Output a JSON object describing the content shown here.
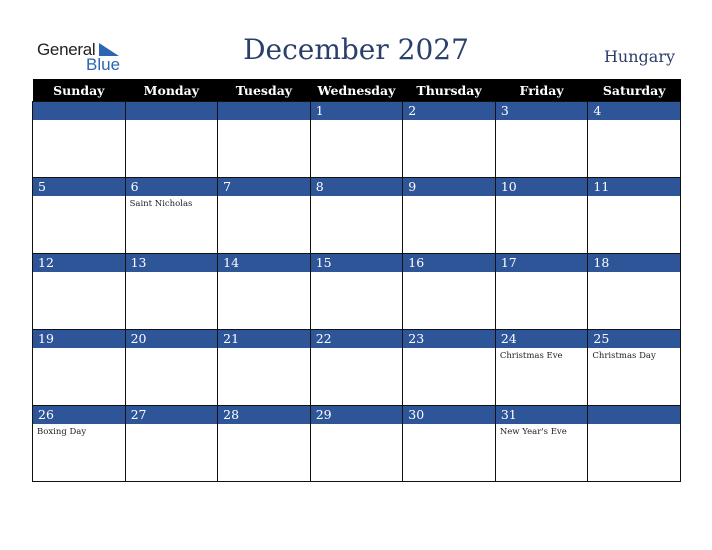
{
  "logo": {
    "word1": "General",
    "word2": "Blue"
  },
  "title": "December 2027",
  "country": "Hungary",
  "colors": {
    "band": "#2e5597",
    "header": "#000000",
    "title": "#2b3f6b"
  },
  "weekdays": [
    "Sunday",
    "Monday",
    "Tuesday",
    "Wednesday",
    "Thursday",
    "Friday",
    "Saturday"
  ],
  "weeks": [
    [
      {
        "day": "",
        "holiday": ""
      },
      {
        "day": "",
        "holiday": ""
      },
      {
        "day": "",
        "holiday": ""
      },
      {
        "day": "1",
        "holiday": ""
      },
      {
        "day": "2",
        "holiday": ""
      },
      {
        "day": "3",
        "holiday": ""
      },
      {
        "day": "4",
        "holiday": ""
      }
    ],
    [
      {
        "day": "5",
        "holiday": ""
      },
      {
        "day": "6",
        "holiday": "Saint Nicholas"
      },
      {
        "day": "7",
        "holiday": ""
      },
      {
        "day": "8",
        "holiday": ""
      },
      {
        "day": "9",
        "holiday": ""
      },
      {
        "day": "10",
        "holiday": ""
      },
      {
        "day": "11",
        "holiday": ""
      }
    ],
    [
      {
        "day": "12",
        "holiday": ""
      },
      {
        "day": "13",
        "holiday": ""
      },
      {
        "day": "14",
        "holiday": ""
      },
      {
        "day": "15",
        "holiday": ""
      },
      {
        "day": "16",
        "holiday": ""
      },
      {
        "day": "17",
        "holiday": ""
      },
      {
        "day": "18",
        "holiday": ""
      }
    ],
    [
      {
        "day": "19",
        "holiday": ""
      },
      {
        "day": "20",
        "holiday": ""
      },
      {
        "day": "21",
        "holiday": ""
      },
      {
        "day": "22",
        "holiday": ""
      },
      {
        "day": "23",
        "holiday": ""
      },
      {
        "day": "24",
        "holiday": "Christmas Eve"
      },
      {
        "day": "25",
        "holiday": "Christmas Day"
      }
    ],
    [
      {
        "day": "26",
        "holiday": "Boxing Day"
      },
      {
        "day": "27",
        "holiday": ""
      },
      {
        "day": "28",
        "holiday": ""
      },
      {
        "day": "29",
        "holiday": ""
      },
      {
        "day": "30",
        "holiday": ""
      },
      {
        "day": "31",
        "holiday": "New Year's Eve"
      },
      {
        "day": "",
        "holiday": ""
      }
    ]
  ]
}
